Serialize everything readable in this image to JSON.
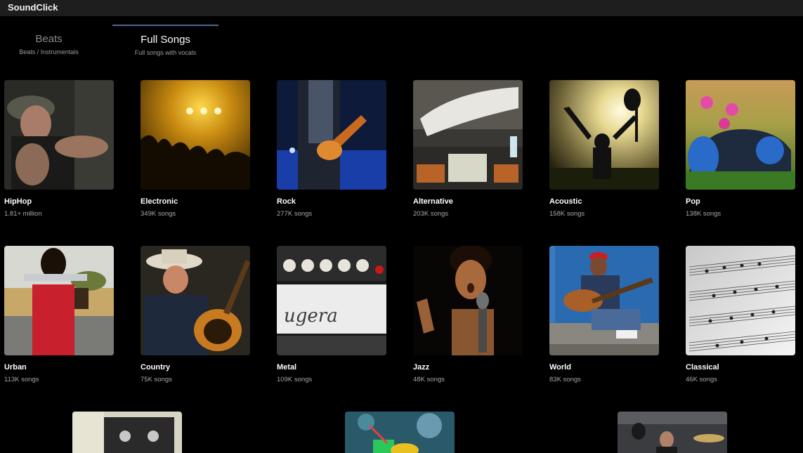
{
  "app": {
    "title": "SoundClick"
  },
  "tabs": [
    {
      "label": "Beats",
      "sub": "Beats / Instrumentals",
      "active": false
    },
    {
      "label": "Full Songs",
      "sub": "Full songs with vocals",
      "active": true
    }
  ],
  "genres": [
    {
      "name": "HipHop",
      "count": "1.81+ million"
    },
    {
      "name": "Electronic",
      "count": "349K songs"
    },
    {
      "name": "Rock",
      "count": "277K songs"
    },
    {
      "name": "Alternative",
      "count": "203K songs"
    },
    {
      "name": "Acoustic",
      "count": "158K songs"
    },
    {
      "name": "Pop",
      "count": "138K songs"
    },
    {
      "name": "Urban",
      "count": "113K songs"
    },
    {
      "name": "Country",
      "count": "75K songs"
    },
    {
      "name": "Metal",
      "count": "109K songs"
    },
    {
      "name": "Jazz",
      "count": "48K songs"
    },
    {
      "name": "World",
      "count": "83K songs"
    },
    {
      "name": "Classical",
      "count": "46K songs"
    }
  ],
  "colors": {
    "titlebar": "#1e1e1e",
    "background": "#000000",
    "tab_indicator": "#4a6c8c",
    "muted_text": "#a8a8a8"
  }
}
